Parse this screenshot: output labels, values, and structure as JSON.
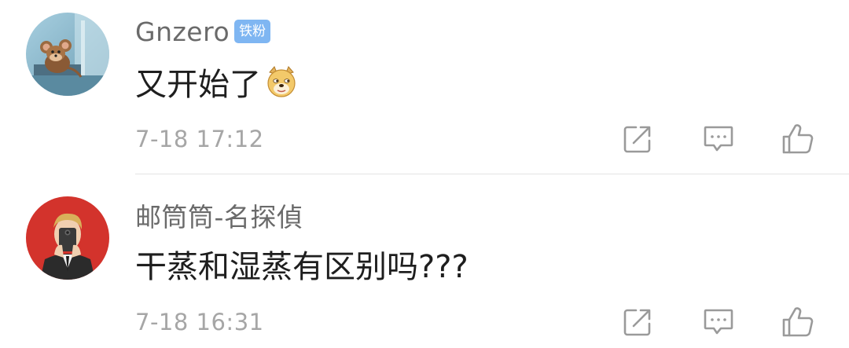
{
  "comments": [
    {
      "username": "Gnzero",
      "badge": "铁粉",
      "text": "又开始了",
      "emoji": "doge-emoji",
      "timestamp": "7-18 17:12",
      "avatar": "jerry-mouse-avatar"
    },
    {
      "username": "邮筒筒-名探偵",
      "text": "干蒸和湿蒸有区别吗???",
      "timestamp": "7-18 16:31",
      "avatar": "man-with-phone-avatar"
    }
  ],
  "icons": {
    "share": "share-icon",
    "comment": "comment-icon",
    "like": "thumbs-up-icon"
  },
  "colors": {
    "username": "#6a6a6a",
    "content": "#1e1e1e",
    "timestamp": "#a6a6a6",
    "badge_bg": "#7fb6f2",
    "icon": "#9a9a9a",
    "divider": "#e3e3e3",
    "avatar2_bg": "#d3332c"
  }
}
